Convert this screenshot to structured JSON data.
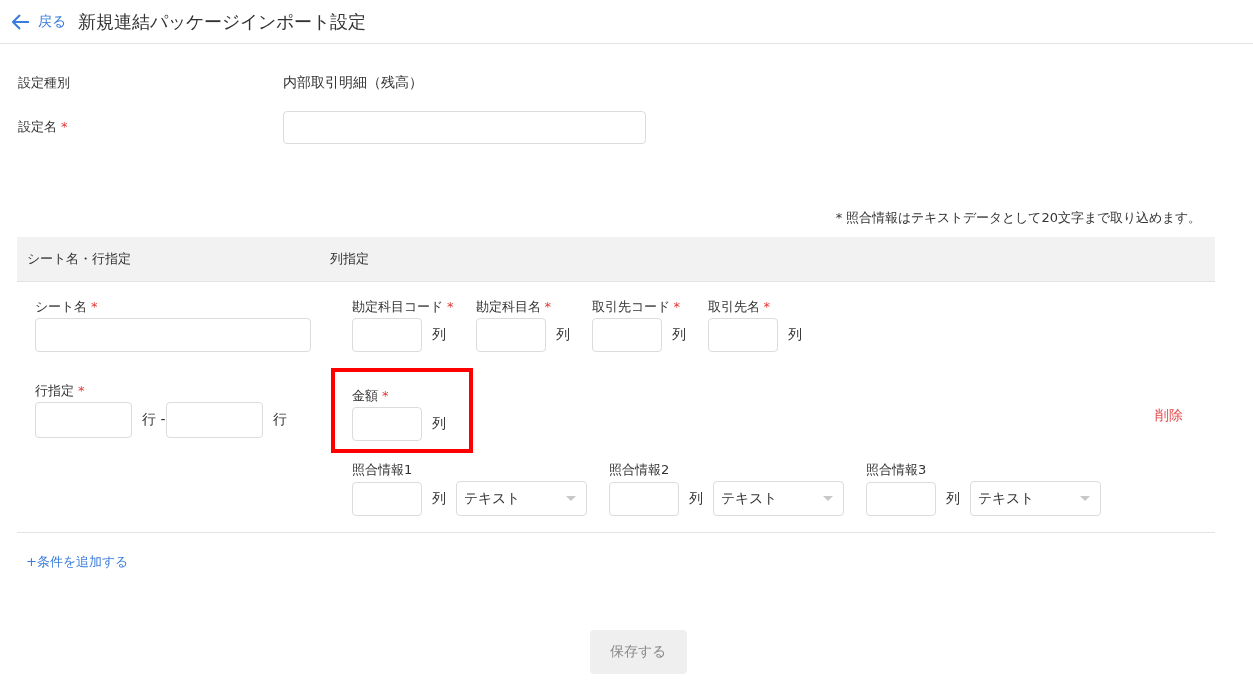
{
  "header": {
    "back_label": "戻る",
    "title": "新規連結パッケージインポート設定"
  },
  "settings": [
    {
      "kind": "text",
      "label": "設定種別",
      "value": "内部取引明細（残高）"
    },
    {
      "kind": "input",
      "label": "設定名",
      "required_mark": "*"
    }
  ],
  "note": "* 照合情報はテキストデータとして20文字まで取り込めます。",
  "table": {
    "columns": [
      "シート名・行指定",
      "列指定"
    ],
    "sheet": {
      "label": "シート名",
      "required_mark": "*"
    },
    "row_spec": {
      "label": "行指定",
      "required_mark": "*",
      "middle_unit": "行 -",
      "end_unit": "行"
    },
    "column_rows": [
      [
        {
          "kind": "column",
          "label": "勘定科目コード",
          "required_mark": "*",
          "unit": "列",
          "highlighted": false
        },
        {
          "kind": "column",
          "label": "勘定科目名",
          "required_mark": "*",
          "unit": "列",
          "highlighted": false
        },
        {
          "kind": "column",
          "label": "取引先コード",
          "required_mark": "*",
          "unit": "列",
          "highlighted": false
        },
        {
          "kind": "column",
          "label": "取引先名",
          "required_mark": "*",
          "unit": "列",
          "highlighted": false
        }
      ],
      [
        {
          "kind": "column",
          "label": "金額",
          "required_mark": "*",
          "unit": "列",
          "highlighted": true
        }
      ],
      [
        {
          "kind": "match",
          "label": "照合情報1",
          "unit": "列",
          "select_value": "テキスト",
          "highlighted": false
        },
        {
          "kind": "match",
          "label": "照合情報2",
          "unit": "列",
          "select_value": "テキスト",
          "highlighted": false
        },
        {
          "kind": "match",
          "label": "照合情報3",
          "unit": "列",
          "select_value": "テキスト",
          "highlighted": false
        }
      ]
    ],
    "delete_link": "削除"
  },
  "add_condition": "+条件を追加する",
  "save_button": {
    "label": "保存する",
    "disabled": true
  }
}
